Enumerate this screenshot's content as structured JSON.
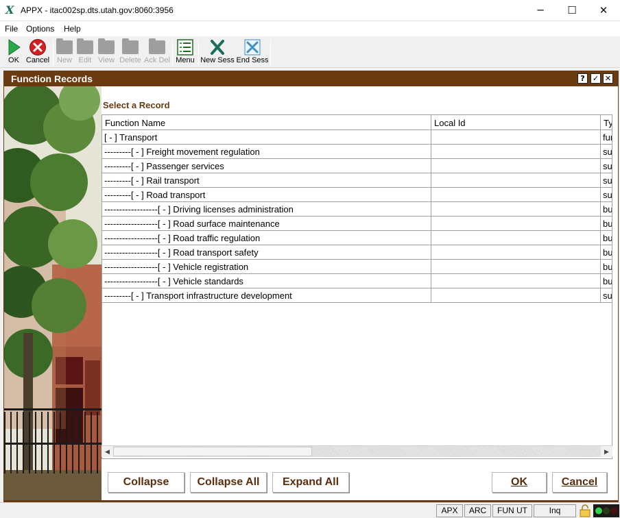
{
  "window": {
    "icon": "appx-x-icon",
    "title": "APPX - itac002sp.dts.utah.gov:8060:3956"
  },
  "window_controls": {
    "minimize": "─",
    "maximize": "☐",
    "close": "✕"
  },
  "menu": [
    "File",
    "Options",
    "Help"
  ],
  "toolbar": {
    "ok": "OK",
    "cancel": "Cancel",
    "new": "New",
    "edit": "Edit",
    "view": "View",
    "delete": "Delete",
    "ack_del": "Ack Del",
    "menu": "Menu",
    "new_sess": "New Sess",
    "end_sess": "End Sess"
  },
  "frame": {
    "title": "Function Records",
    "help": "?",
    "check": "✓",
    "close": "✕"
  },
  "select_label": "Select a Record",
  "grid": {
    "columns": [
      "Function Name",
      "Local Id",
      "Ty"
    ],
    "rows": [
      {
        "name": "[ - ] Transport",
        "local_id": "",
        "type": "fur"
      },
      {
        "name": "---------[ - ] Freight movement regulation",
        "local_id": "",
        "type": "su"
      },
      {
        "name": "---------[ - ] Passenger services",
        "local_id": "",
        "type": "su"
      },
      {
        "name": "---------[ - ] Rail transport",
        "local_id": "",
        "type": "su"
      },
      {
        "name": "---------[ - ] Road transport",
        "local_id": "",
        "type": "su"
      },
      {
        "name": "------------------[ - ] Driving licenses administration",
        "local_id": "",
        "type": "bu"
      },
      {
        "name": "------------------[ - ] Road surface maintenance",
        "local_id": "",
        "type": "bu"
      },
      {
        "name": "------------------[ - ] Road traffic regulation",
        "local_id": "",
        "type": "bu"
      },
      {
        "name": "------------------[ - ] Road transport safety",
        "local_id": "",
        "type": "bu"
      },
      {
        "name": "------------------[ - ] Vehicle registration",
        "local_id": "",
        "type": "bu"
      },
      {
        "name": "------------------[ - ] Vehicle standards",
        "local_id": "",
        "type": "bu"
      },
      {
        "name": "---------[ - ] Transport infrastructure development",
        "local_id": "",
        "type": "su"
      }
    ]
  },
  "scrollbar": {
    "left": "◀",
    "right": "▶"
  },
  "buttons": {
    "collapse": "Collapse",
    "collapse_all": "Collapse All",
    "expand_all": "Expand All",
    "ok": "OK",
    "cancel": "Cancel"
  },
  "status": {
    "apx": "APX",
    "arc": "ARC",
    "fun_ut": "FUN UT",
    "mode": "Inq"
  },
  "colors": {
    "brand": "#6a3a11",
    "ok_green": "#2aa84a",
    "cancel_red": "#d32020"
  }
}
